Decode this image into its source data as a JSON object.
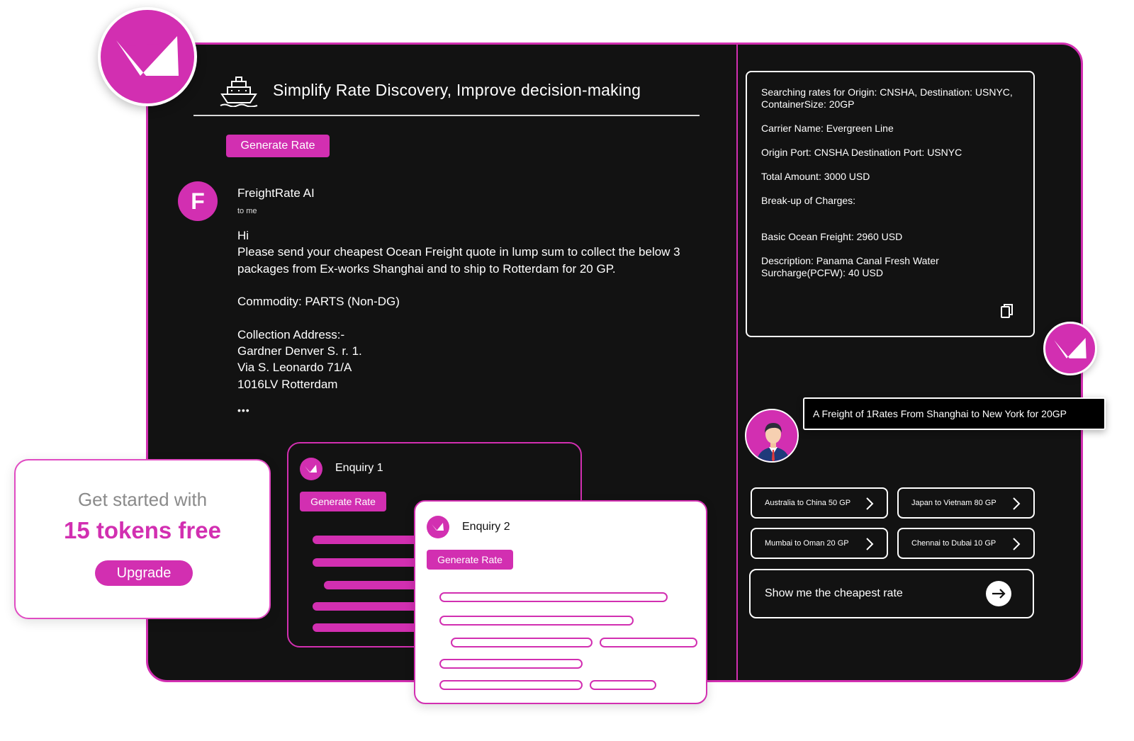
{
  "header": {
    "title": "Simplify Rate Discovery, Improve decision-making",
    "ship_icon": "ship-icon"
  },
  "main": {
    "generate_label": "Generate Rate"
  },
  "email": {
    "avatar_letter": "F",
    "sender": "FreightRate AI",
    "to": "to me",
    "body": "Hi\nPlease send your cheapest Ocean Freight quote in lump sum to collect the below 3 packages from Ex-works Shanghai and to ship to Rotterdam for 20 GP.\n\nCommodity: PARTS (Non-DG)\n\nCollection Address:-\nGardner Denver S. r. 1.\nVia S. Leonardo 71/A\n1016LV Rotterdam",
    "more": "•••"
  },
  "enquiry1": {
    "title": "Enquiry 1",
    "button": "Generate Rate"
  },
  "enquiry2": {
    "title": "Enquiry 2",
    "button": "Generate Rate"
  },
  "promo": {
    "subtitle": "Get started with",
    "headline": "15 tokens free",
    "button": "Upgrade"
  },
  "result": {
    "searching": "Searching rates for Origin: CNSHA, Destination: USNYC, ContainerSize: 20GP",
    "carrier": "Carrier Name: Evergreen Line",
    "ports": "Origin Port: CNSHA Destination Port: USNYC",
    "total": "Total Amount: 3000 USD",
    "breakup": "Break-up of Charges:",
    "basic": "Basic Ocean Freight: 2960 USD",
    "description": "Description: Panama Canal Fresh Water Surcharge(PCFW):  40 USD",
    "copy_icon": "copy-icon"
  },
  "chat": {
    "user_message": "A Freight of 1Rates From Shanghai to New York for 20GP",
    "suggestions": [
      "Australia to China 50 GP",
      "Japan to Vietnam 80 GP",
      "Mumbai to Oman 20 GP",
      "Chennai to Dubai 10 GP"
    ],
    "input_text": "Show me the cheapest rate",
    "send_icon": "arrow-right-icon"
  },
  "colors": {
    "accent": "#d22fb1",
    "panel": "#121212",
    "white": "#ffffff"
  }
}
